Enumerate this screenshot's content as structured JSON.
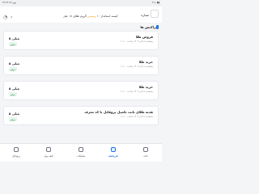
{
  "status": {
    "left": "۴۲:۴۴ ۲۷ مهر",
    "right": "۴۱٪ ▮▮"
  },
  "header": {
    "brand_text": "ستاره",
    "promo_prefix": "کیسه استانداز ۱۰",
    "promo_highlight": "وسپس",
    "promo_suffix": " گروم طلای ۱۸ عیار",
    "icons": {
      "notification": "notification-icon",
      "chevron": "chevron-left-icon"
    }
  },
  "section": {
    "title": "تراکنش ها"
  },
  "transactions": [
    {
      "title": "فروش طلا",
      "meta": "پنجشنبه ۸ آبان ۱۴۰۳ ساعت ۱۱:۱۰",
      "amount": "۵ میلی",
      "badge": "موفق"
    },
    {
      "title": "خرید طلا",
      "meta": "پنجشنبه ۸ آبان ۱۴۰۳ ساعت ۱۱:۱۰",
      "amount": "۵ میلی",
      "badge": "موفق"
    },
    {
      "title": "خرید طلا",
      "meta": "پنجشنبه ۸ آبان ۱۴۰۳ ساعت ۱۱:۱۰",
      "amount": "۵ میلی",
      "badge": "موفق"
    },
    {
      "title": "هدیه طلای بابت تکمیل پروفایل با کد معرف",
      "meta": "پنجشنبه ۸ آبان ۱۴۰۳ ساعت ۱۱:۱۰",
      "amount": "۵ میلی",
      "badge": "موفق"
    }
  ],
  "tabs": [
    {
      "label": "پروفایل",
      "active": false
    },
    {
      "label": "کیف پول",
      "active": false
    },
    {
      "label": "معاملات",
      "active": false
    },
    {
      "label": "تاریخچه",
      "active": true
    },
    {
      "label": "خانه",
      "active": false
    }
  ],
  "colors": {
    "accent": "#1a73e8",
    "success": "#2c8f4e",
    "highlight": "#f5a623"
  }
}
